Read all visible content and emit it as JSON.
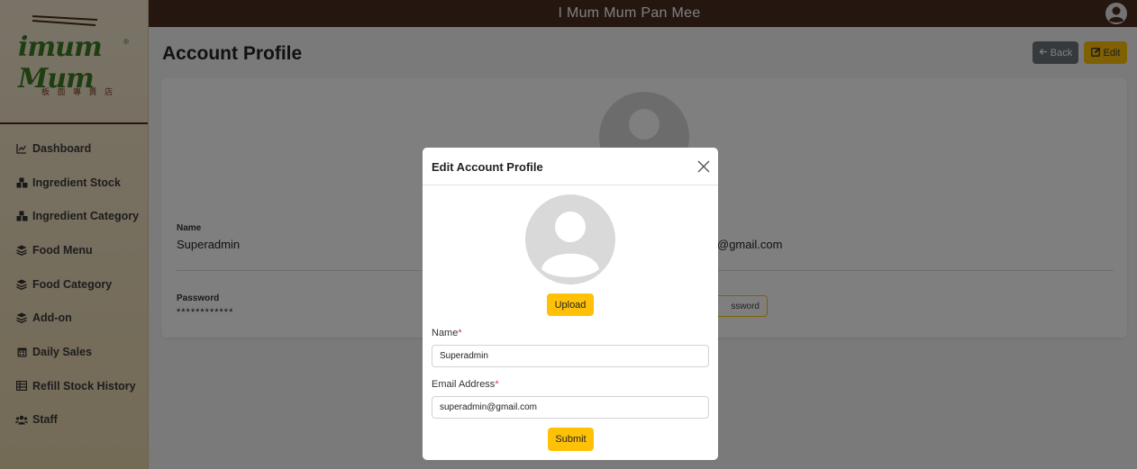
{
  "app": {
    "title": "I Mum Mum Pan Mee"
  },
  "logo": {
    "text": "imum Mum",
    "subtitle": "板 面 專 賣 店",
    "reg": "®"
  },
  "sidebar": {
    "items": [
      {
        "label": "Dashboard",
        "icon": "chart-line-icon"
      },
      {
        "label": "Ingredient Stock",
        "icon": "cubes-icon"
      },
      {
        "label": "Ingredient Category",
        "icon": "cubes-icon"
      },
      {
        "label": "Food Menu",
        "icon": "layer-group-icon"
      },
      {
        "label": "Food Category",
        "icon": "layer-group-icon"
      },
      {
        "label": "Add-on",
        "icon": "layer-group-icon"
      },
      {
        "label": "Daily Sales",
        "icon": "calendar-icon"
      },
      {
        "label": "Refill Stock History",
        "icon": "table-icon"
      },
      {
        "label": "Staff",
        "icon": "users-icon"
      }
    ]
  },
  "page": {
    "title": "Account Profile",
    "back_label": "Back",
    "edit_label": "Edit",
    "name_label": "Name",
    "name_value": "Superadmin",
    "email_value_partial": "@gmail.com",
    "password_label": "Password",
    "password_value": "************",
    "change_password_partial": "ssword"
  },
  "modal": {
    "title": "Edit Account Profile",
    "upload_label": "Upload",
    "name_label": "Name",
    "name_value": "Superadmin",
    "email_label": "Email Address",
    "email_value": "superadmin@gmail.com",
    "required_mark": "*",
    "submit_label": "Submit"
  },
  "colors": {
    "topbar": "#4a2d1f",
    "accent": "#ffc107",
    "secondary": "#6c757d",
    "sidebar_bg": "#ecdcb9"
  }
}
